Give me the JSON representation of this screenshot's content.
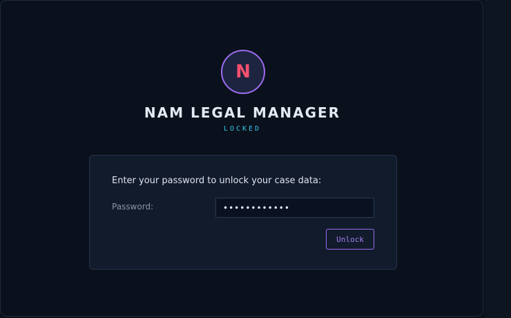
{
  "app": {
    "logo_letter": "N",
    "title": "NAM LEGAL MANAGER",
    "status": "LOCKED"
  },
  "unlock_form": {
    "prompt": "Enter your password to unlock your case data:",
    "password_label": "Password:",
    "password_value": "••••••••••••",
    "unlock_label": "Unlock"
  },
  "colors": {
    "background": "#0a111c",
    "card": "#111b2c",
    "accent_purple": "#9f6cf0",
    "logo_letter": "#f5506e",
    "status_cyan": "#35c5e8"
  }
}
